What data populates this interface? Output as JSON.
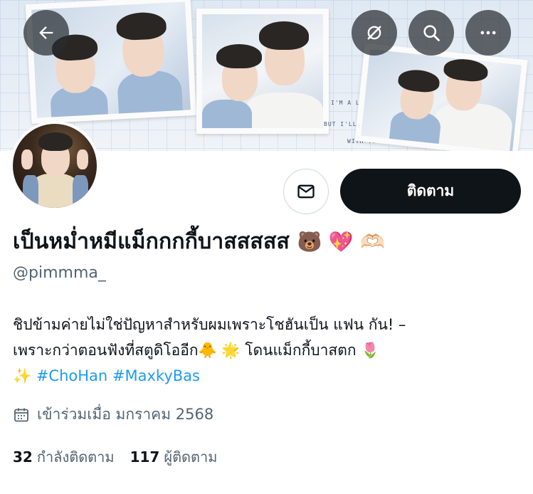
{
  "banner": {
    "caption_lines": [
      "I'M A LITTLE COLD",
      "BUT I'LL WARM UP",
      "WITH YOU"
    ]
  },
  "header_buttons": {
    "back_icon": "back-arrow-icon",
    "grok_icon": "grok-slash-icon",
    "search_icon": "search-icon",
    "more_icon": "more-dots-icon"
  },
  "actions": {
    "message_icon": "envelope-icon",
    "follow_label": "ติดตาม"
  },
  "profile": {
    "display_name": "เป็นหม่ำหมีแม็กกกกี้บาสสสสส",
    "name_emojis": "🐻 💖 🫶🏻",
    "handle": "@pimmma_",
    "bio_line1": "ชิปข้ามค่ายไม่ใช่ปัญหาสำหรับผมเพราะโชฮันเป็น แฟน กัน! –",
    "bio_line2": "เพราะกว่าตอนฟังที่สตูดิโออีก🐥 🌟  โดนแม็กกี้บาสตก 🌷",
    "bio_line3_prefix": "✨ ",
    "hashtag1": "#ChoHan",
    "hashtag2": "#MaxkyBas",
    "joined": "เข้าร่วมเมื่อ มกราคม 2568",
    "following_count": "32",
    "following_label": "กำลังติดตาม",
    "followers_count": "117",
    "followers_label": "ผู้ติดตาม"
  },
  "colors": {
    "accent": "#1d9bf0",
    "text": "#0f1419",
    "secondary": "#536471",
    "follow_bg": "#0f1419"
  }
}
